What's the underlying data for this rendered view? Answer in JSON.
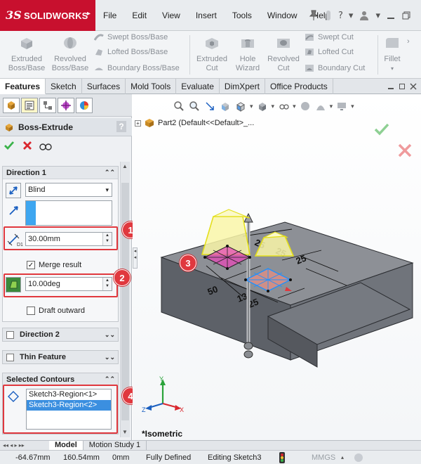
{
  "app": {
    "brand_ds": "3S",
    "brand_name": "SOLIDWORKS"
  },
  "menu": [
    "File",
    "Edit",
    "View",
    "Insert",
    "Tools",
    "Window",
    "Help"
  ],
  "toolbar_right": {
    "pin_icon": "pin-icon",
    "help": "?"
  },
  "commands": {
    "extruded_boss": [
      "Extruded",
      "Boss/Base"
    ],
    "revolved_boss": [
      "Revolved",
      "Boss/Base"
    ],
    "swept_boss": "Swept Boss/Base",
    "lofted_boss": "Lofted Boss/Base",
    "boundary_boss": "Boundary Boss/Base",
    "extruded_cut": [
      "Extruded",
      "Cut"
    ],
    "hole_wizard": [
      "Hole",
      "Wizard"
    ],
    "revolved_cut": [
      "Revolved",
      "Cut"
    ],
    "swept_cut": "Swept Cut",
    "lofted_cut": "Lofted Cut",
    "boundary_cut": "Boundary Cut",
    "fillet": "Fillet"
  },
  "tabs": [
    "Features",
    "Sketch",
    "Surfaces",
    "Mold Tools",
    "Evaluate",
    "DimXpert",
    "Office Products"
  ],
  "property_manager": {
    "title": "Boss-Extrude",
    "help": "?",
    "direction1": {
      "header": "Direction 1",
      "end_condition": "Blind",
      "depth": "30.00mm",
      "depth_label": "D1",
      "merge_result": "Merge result",
      "draft_angle": "10.00deg",
      "draft_outward": "Draft outward"
    },
    "direction2": {
      "header": "Direction 2"
    },
    "thin_feature": {
      "header": "Thin Feature"
    },
    "selected_contours": {
      "header": "Selected Contours",
      "items": [
        "Sketch3-Region<1>",
        "Sketch3-Region<2>"
      ]
    }
  },
  "callouts": [
    "1",
    "2",
    "3",
    "4"
  ],
  "graphics": {
    "tree_node": "Part2  (Default<<Default>_...",
    "view_label": "*Isometric",
    "dims": [
      "25",
      "25",
      "25",
      "25",
      "50",
      "13"
    ],
    "triad": {
      "x": "X",
      "y": "Y",
      "z": "Z"
    }
  },
  "bottom_tabs": [
    "Model",
    "Motion Study 1"
  ],
  "status": {
    "x": "-64.67mm",
    "y": "160.54mm",
    "z": "0mm",
    "state": "Fully Defined",
    "mode": "Editing Sketch3",
    "units": "MMGS"
  },
  "colors": {
    "brand": "#c8102e",
    "callout": "#e0383e",
    "accept": "#3bb34a",
    "cancel": "#d9282f",
    "sketch": "#e64ab7",
    "preview": "#f2f028",
    "selection": "#1e90ff"
  }
}
